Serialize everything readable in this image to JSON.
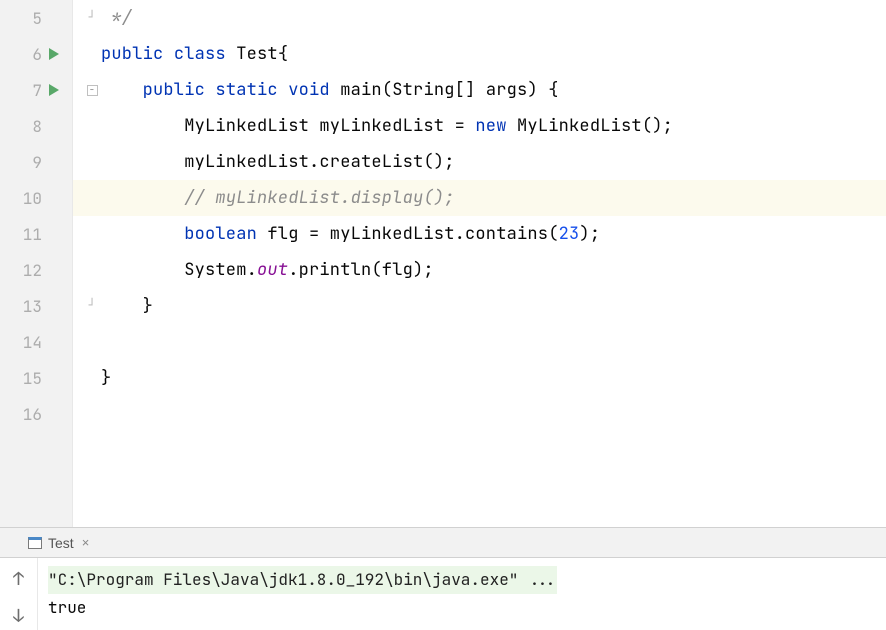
{
  "editor": {
    "lines": [
      {
        "num": "5",
        "run": false,
        "highlight": false,
        "foldStart": false,
        "foldEnd": true,
        "tokens": [
          {
            "txt": " ",
            "cls": ""
          },
          {
            "txt": "*/",
            "cls": "comment"
          }
        ]
      },
      {
        "num": "6",
        "run": true,
        "highlight": false,
        "foldStart": false,
        "foldEnd": false,
        "tokens": [
          {
            "txt": "public ",
            "cls": "kw"
          },
          {
            "txt": "class ",
            "cls": "kw"
          },
          {
            "txt": "Test",
            "cls": "plain"
          },
          {
            "txt": "{",
            "cls": "plain"
          }
        ]
      },
      {
        "num": "7",
        "run": true,
        "highlight": false,
        "foldStart": true,
        "foldEnd": false,
        "tokens": [
          {
            "txt": "    ",
            "cls": ""
          },
          {
            "txt": "public ",
            "cls": "kw"
          },
          {
            "txt": "static ",
            "cls": "kw"
          },
          {
            "txt": "void ",
            "cls": "kw"
          },
          {
            "txt": "main",
            "cls": "plain"
          },
          {
            "txt": "(String[] args) {",
            "cls": "plain"
          }
        ]
      },
      {
        "num": "8",
        "run": false,
        "highlight": false,
        "foldStart": false,
        "foldEnd": false,
        "tokens": [
          {
            "txt": "        MyLinkedList myLinkedList = ",
            "cls": "plain"
          },
          {
            "txt": "new ",
            "cls": "kw"
          },
          {
            "txt": "MyLinkedList();",
            "cls": "plain"
          }
        ]
      },
      {
        "num": "9",
        "run": false,
        "highlight": false,
        "foldStart": false,
        "foldEnd": false,
        "tokens": [
          {
            "txt": "        myLinkedList.createList();",
            "cls": "plain"
          }
        ]
      },
      {
        "num": "10",
        "run": false,
        "highlight": true,
        "foldStart": false,
        "foldEnd": false,
        "tokens": [
          {
            "txt": "        ",
            "cls": ""
          },
          {
            "txt": "// myLinkedList.display();",
            "cls": "comment"
          }
        ]
      },
      {
        "num": "11",
        "run": false,
        "highlight": false,
        "foldStart": false,
        "foldEnd": false,
        "tokens": [
          {
            "txt": "        ",
            "cls": ""
          },
          {
            "txt": "boolean ",
            "cls": "kw"
          },
          {
            "txt": "flg = myLinkedList.contains(",
            "cls": "plain"
          },
          {
            "txt": "23",
            "cls": "num"
          },
          {
            "txt": ");",
            "cls": "plain"
          }
        ]
      },
      {
        "num": "12",
        "run": false,
        "highlight": false,
        "foldStart": false,
        "foldEnd": false,
        "tokens": [
          {
            "txt": "        System.",
            "cls": "plain"
          },
          {
            "txt": "out",
            "cls": "field-italic"
          },
          {
            "txt": ".println(flg);",
            "cls": "plain"
          }
        ]
      },
      {
        "num": "13",
        "run": false,
        "highlight": false,
        "foldStart": false,
        "foldEnd": true,
        "tokens": [
          {
            "txt": "    }",
            "cls": "plain"
          }
        ]
      },
      {
        "num": "14",
        "run": false,
        "highlight": false,
        "foldStart": false,
        "foldEnd": false,
        "tokens": [
          {
            "txt": "",
            "cls": ""
          }
        ]
      },
      {
        "num": "15",
        "run": false,
        "highlight": false,
        "foldStart": false,
        "foldEnd": false,
        "tokens": [
          {
            "txt": "}",
            "cls": "plain"
          }
        ]
      },
      {
        "num": "16",
        "run": false,
        "highlight": false,
        "foldStart": false,
        "foldEnd": false,
        "tokens": [
          {
            "txt": "",
            "cls": ""
          }
        ]
      }
    ]
  },
  "console": {
    "tabLabel": "Test",
    "commandLine": "\"C:\\Program Files\\Java\\jdk1.8.0_192\\bin\\java.exe\" ...",
    "outputLines": [
      "true"
    ]
  }
}
